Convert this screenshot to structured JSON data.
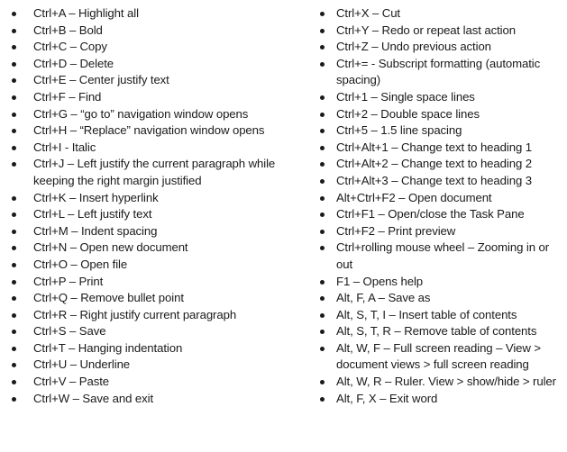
{
  "left_column": [
    "Ctrl+A – Highlight all",
    "Ctrl+B – Bold",
    "Ctrl+C – Copy",
    "Ctrl+D – Delete",
    "Ctrl+E – Center justify text",
    "Ctrl+F – Find",
    "Ctrl+G – “go to” navigation window opens",
    "Ctrl+H – “Replace” navigation window opens",
    "Ctrl+I - Italic",
    "Ctrl+J – Left justify the current paragraph while keeping the right margin justified",
    "Ctrl+K – Insert hyperlink",
    "Ctrl+L – Left justify text",
    "Ctrl+M – Indent spacing",
    "Ctrl+N – Open new document",
    "Ctrl+O – Open file",
    "Ctrl+P – Print",
    "Ctrl+Q – Remove bullet point",
    "Ctrl+R – Right justify current paragraph",
    "Ctrl+S – Save",
    "Ctrl+T – Hanging indentation",
    "Ctrl+U – Underline",
    "Ctrl+V – Paste",
    "Ctrl+W – Save and exit"
  ],
  "right_column": [
    "Ctrl+X – Cut",
    "Ctrl+Y – Redo or repeat last action",
    "Ctrl+Z – Undo previous action",
    "Ctrl+= - Subscript formatting (automatic spacing)",
    "Ctrl+1 – Single space lines",
    "Ctrl+2 – Double space lines",
    "Ctrl+5 – 1.5 line spacing",
    "Ctrl+Alt+1 – Change text to heading 1",
    "Ctrl+Alt+2 – Change text to heading 2",
    "Ctrl+Alt+3 – Change text to heading 3",
    "Alt+Ctrl+F2 – Open document",
    "Ctrl+F1 – Open/close the Task Pane",
    "Ctrl+F2 – Print preview",
    "Ctrl+rolling mouse wheel – Zooming in or out",
    "F1 – Opens help",
    "Alt, F, A – Save as",
    "Alt, S, T, I – Insert table of contents",
    "Alt, S, T, R – Remove table of contents",
    "Alt, W, F – Full screen reading – View > document views > full screen reading",
    "Alt, W, R – Ruler. View > show/hide > ruler",
    "Alt, F, X – Exit word"
  ]
}
